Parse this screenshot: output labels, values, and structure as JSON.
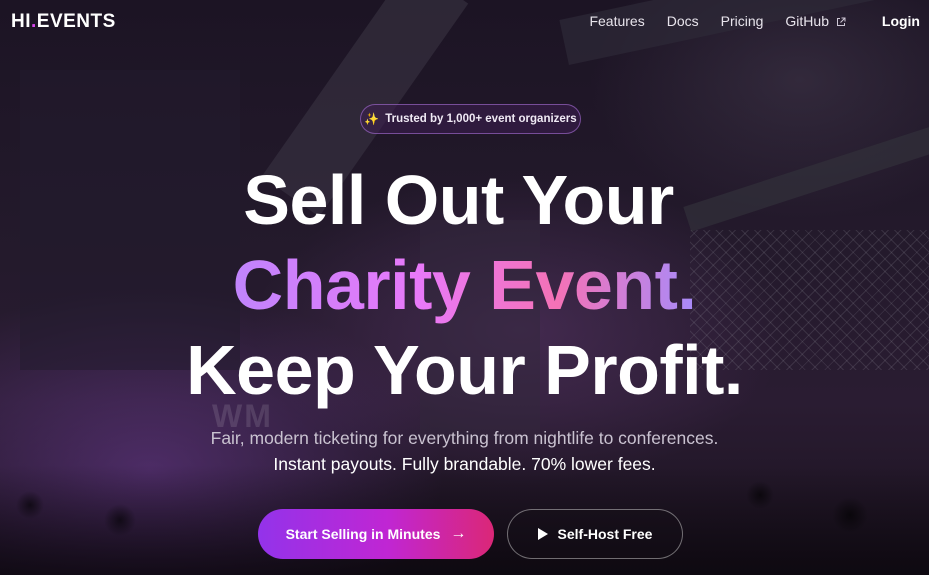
{
  "header": {
    "logo_prefix": "HI",
    "logo_dot": ".",
    "logo_suffix": "EVENTS",
    "nav": {
      "features": "Features",
      "docs": "Docs",
      "pricing": "Pricing",
      "github": "GitHub",
      "login": "Login"
    }
  },
  "hero": {
    "badge_icon": "✨",
    "badge_text": "Trusted by 1,000+ event organizers",
    "headline_line1": "Sell Out Your",
    "headline_line2": "Charity Event.",
    "headline_line3": "Keep Your Profit.",
    "subtitle_line1": "Fair, modern ticketing for everything from nightlife to conferences.",
    "subtitle_line2": "Instant payouts. Fully brandable. 70% lower fees.",
    "primary_cta": "Start Selling in Minutes",
    "primary_cta_arrow": "→",
    "secondary_cta": "Self-Host Free"
  },
  "background_watermark": "WM",
  "colors": {
    "accent_purple": "#9333ea",
    "accent_pink": "#db2777",
    "logo_dot": "#d946ef",
    "gradient_text_start": "#c084fc",
    "gradient_text_end": "#f472b6"
  }
}
